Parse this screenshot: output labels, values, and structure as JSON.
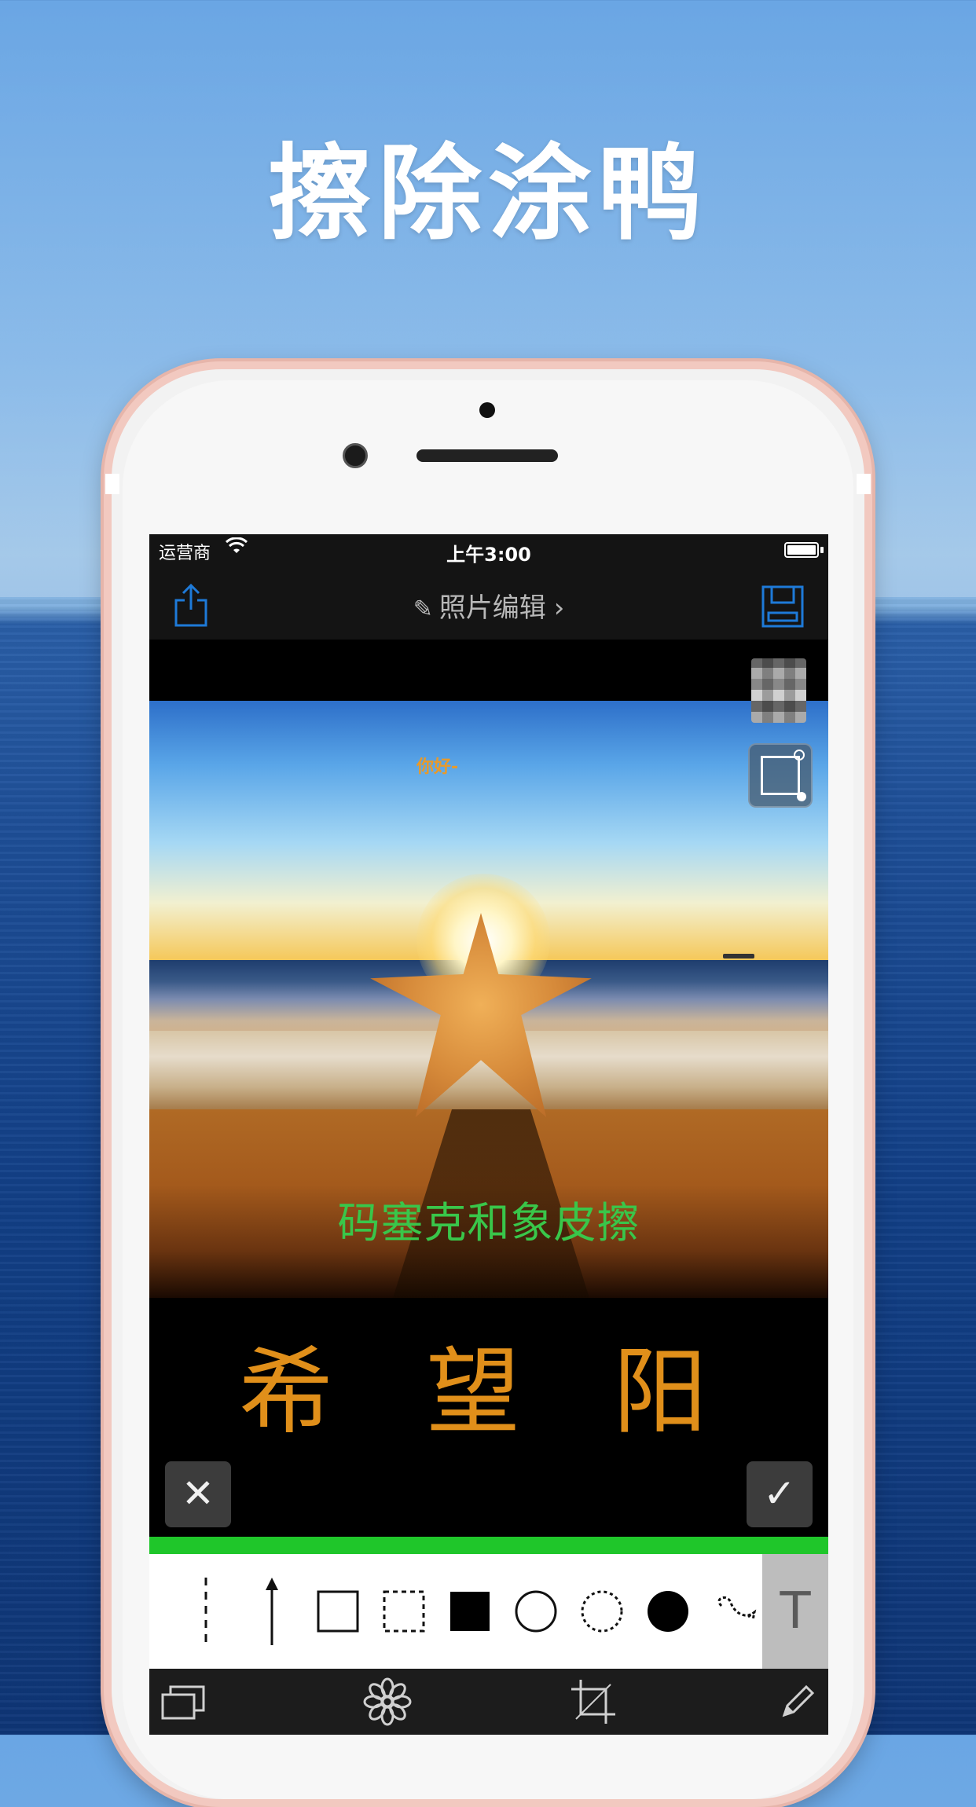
{
  "headline": "擦除涂鸭",
  "status_bar": {
    "carrier": "运营商",
    "time": "上午3:00"
  },
  "nav": {
    "title": "照片编辑",
    "pen_icon": "pencil-icon",
    "chevron": "›"
  },
  "canvas": {
    "small_text": "你好-",
    "green_text": "码塞克和象皮擦",
    "orange_text": "希 望 阳",
    "cancel_glyph": "✕",
    "confirm_glyph": "✓"
  },
  "tools": [
    {
      "name": "dashed-line-tool",
      "icon": "dashed-line-icon"
    },
    {
      "name": "arrow-tool",
      "icon": "arrow-up-icon"
    },
    {
      "name": "rectangle-outline-tool",
      "icon": "square-outline-icon"
    },
    {
      "name": "rectangle-dashed-tool",
      "icon": "square-dashed-icon"
    },
    {
      "name": "rectangle-filled-tool",
      "icon": "square-filled-icon"
    },
    {
      "name": "circle-outline-tool",
      "icon": "circle-outline-icon"
    },
    {
      "name": "circle-dashed-tool",
      "icon": "circle-dashed-icon"
    },
    {
      "name": "circle-filled-tool",
      "icon": "circle-filled-icon"
    },
    {
      "name": "freehand-tool",
      "icon": "squiggle-icon"
    }
  ],
  "text_tool": {
    "label": "T"
  },
  "colors": {
    "accent_blue": "#1e7ad8",
    "green_bar": "#1fc62a",
    "orange_text": "#e08f1a",
    "green_text": "#39c64a"
  }
}
